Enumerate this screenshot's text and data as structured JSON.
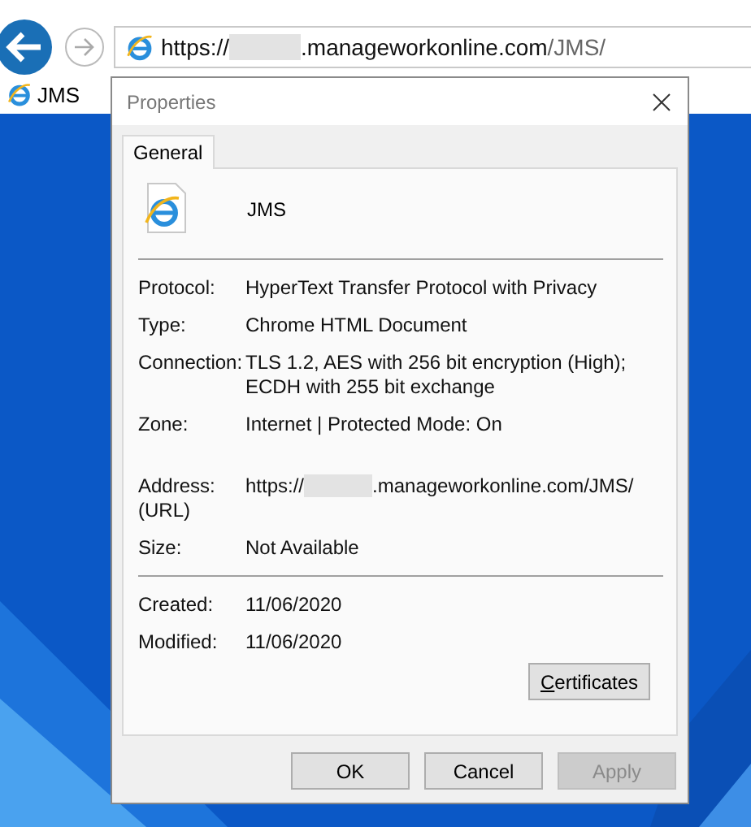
{
  "browser": {
    "address": {
      "scheme": "https://",
      "redacted": true,
      "host": ".manageworkonline.com",
      "path": "/JMS/"
    },
    "tab": {
      "title": "JMS"
    }
  },
  "dialog": {
    "title": "Properties",
    "tabs": [
      {
        "label": "General",
        "selected": true
      }
    ],
    "name": "JMS",
    "groups": [
      {
        "rows": [
          {
            "kind": "text",
            "label": "Protocol:",
            "value": "HyperText Transfer Protocol with Privacy"
          },
          {
            "kind": "text",
            "label": "Type:",
            "value": "Chrome HTML Document"
          },
          {
            "kind": "text",
            "label": "Connection:",
            "value": "TLS 1.2, AES with 256 bit encryption (High); ECDH with 255 bit exchange"
          },
          {
            "kind": "tall",
            "label": "Zone:",
            "value": "Internet | Protected Mode: On"
          },
          {
            "kind": "url",
            "label": "Address:\n(URL)",
            "scheme": "https://",
            "redacted": true,
            "rest": ".manageworkonline.com/JMS/"
          },
          {
            "kind": "text",
            "label": "Size:",
            "value": "Not Available"
          }
        ]
      },
      {
        "rows": [
          {
            "kind": "text",
            "label": "Created:",
            "value": "11/06/2020"
          },
          {
            "kind": "text",
            "label": "Modified:",
            "value": "11/06/2020"
          }
        ]
      }
    ],
    "certificates_button": {
      "label": "Certificates",
      "mnemonic_underlined": true
    },
    "buttons": [
      {
        "label": "OK",
        "disabled": false
      },
      {
        "label": "Cancel",
        "disabled": false
      },
      {
        "label": "Apply",
        "disabled": true
      }
    ]
  }
}
